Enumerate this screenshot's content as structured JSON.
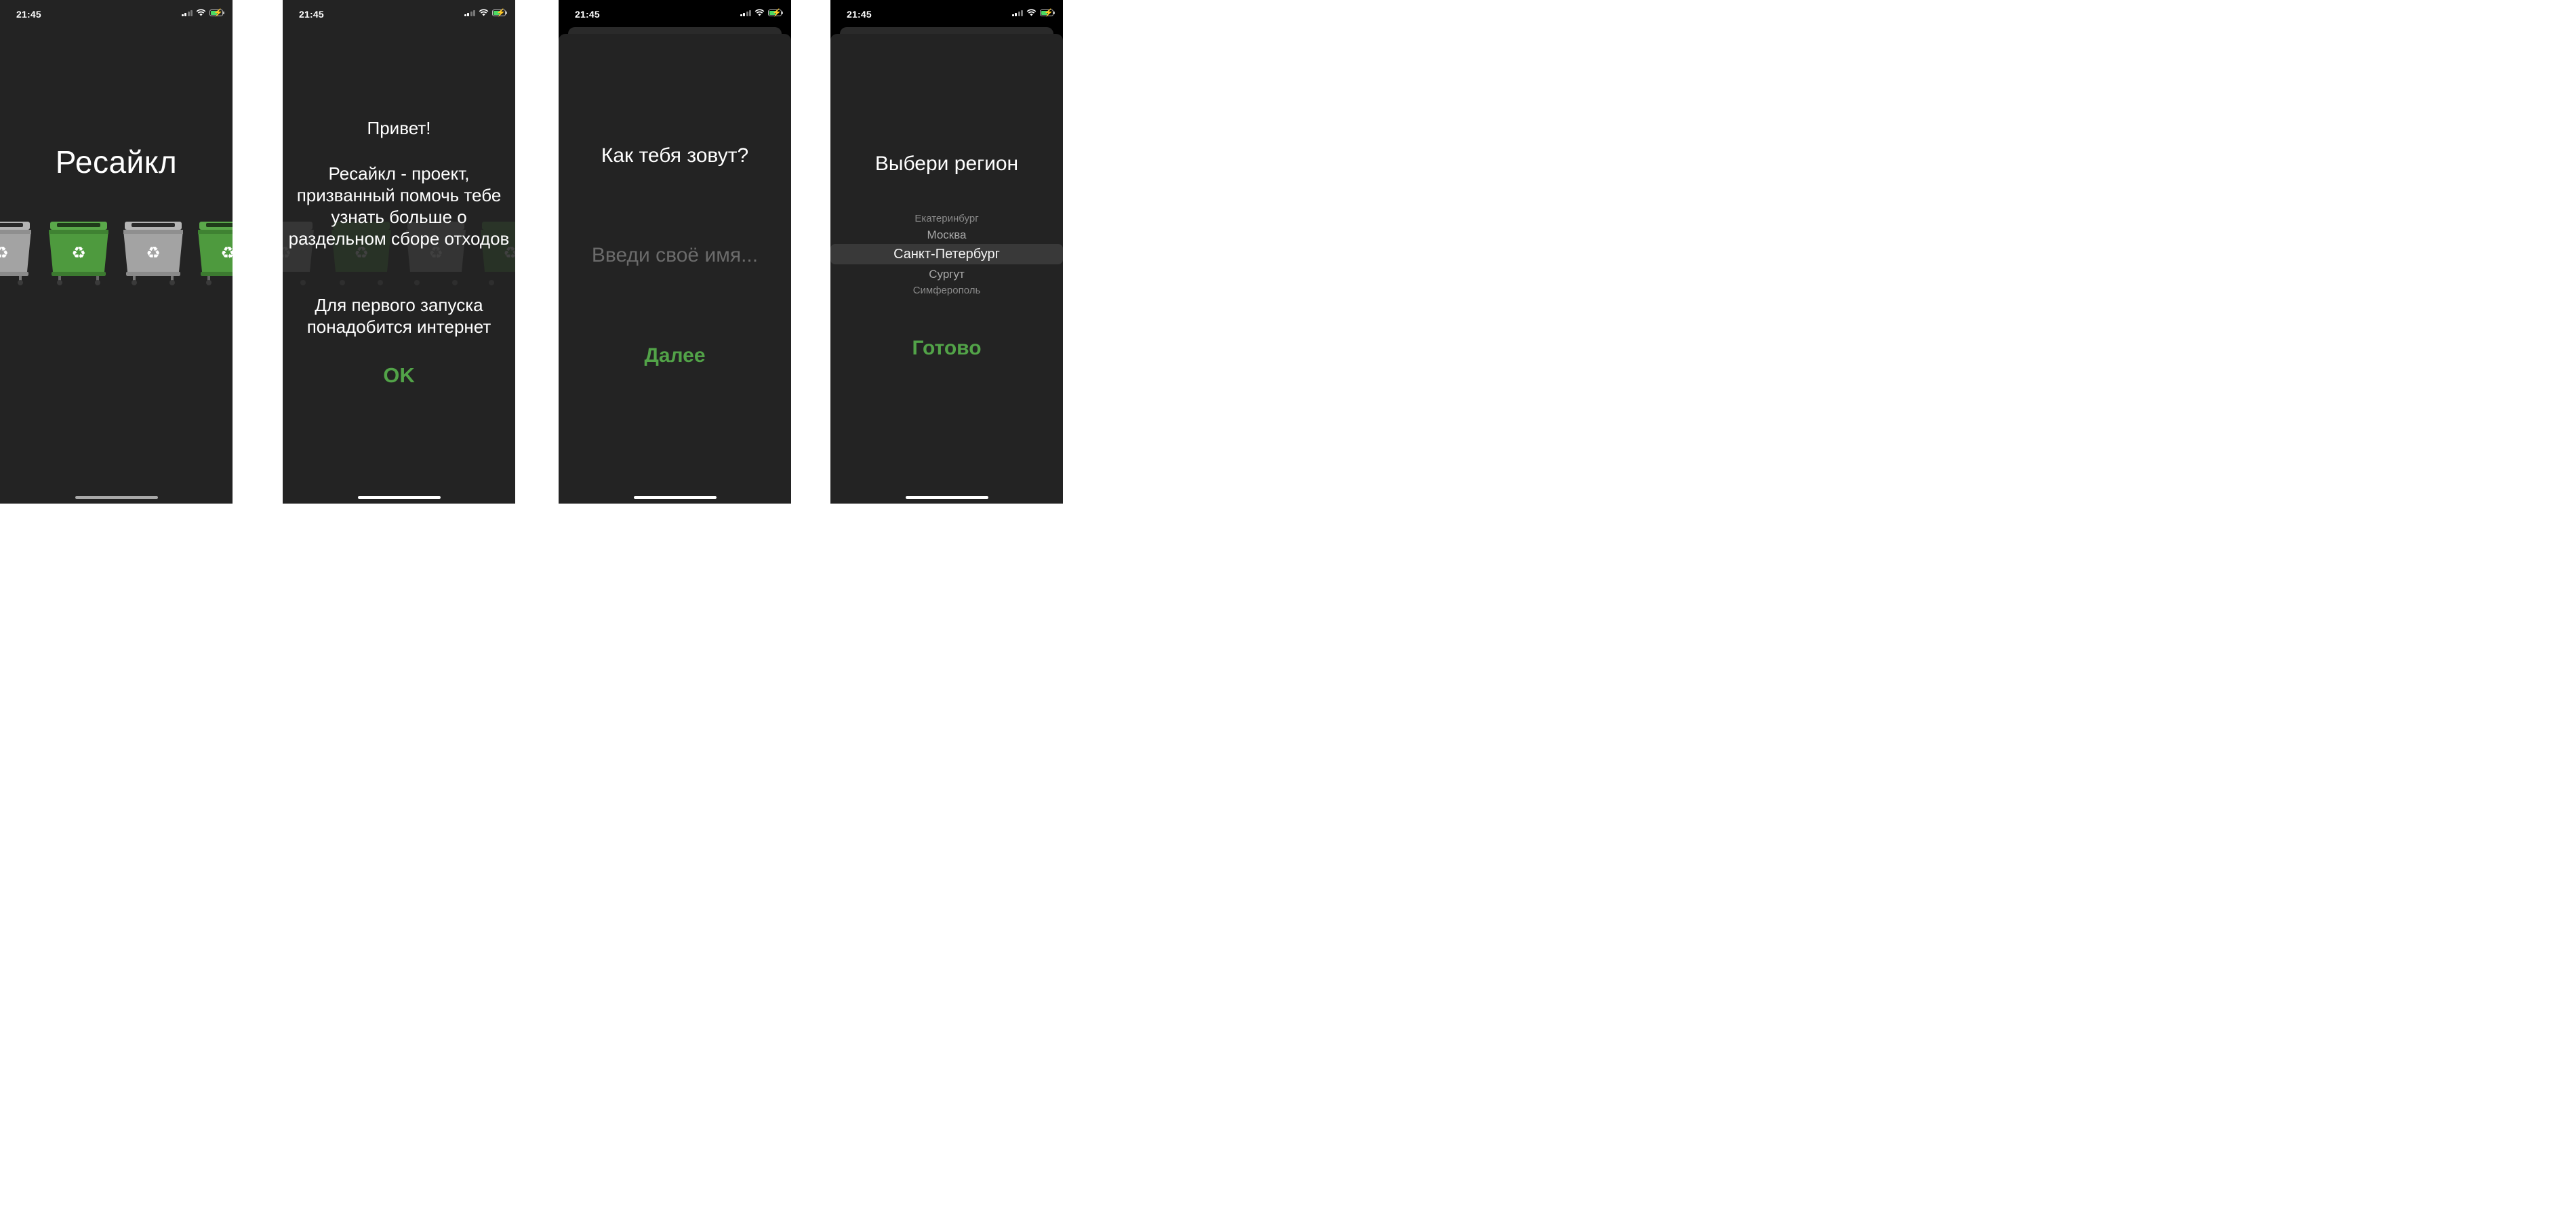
{
  "status": {
    "time": "21:45"
  },
  "colors": {
    "accent_green": "#52a348",
    "background": "#232323",
    "bin_green": "#4e9a3e",
    "bin_grey": "#a3a3a3"
  },
  "screen1": {
    "title": "Ресайкл",
    "bins": [
      "grey-bin",
      "green-bin",
      "grey-bin",
      "green-bin"
    ]
  },
  "screen2": {
    "title": "Привет!",
    "body": "Ресайкл - проект, призванный помочь тебе узнать больше о раздельном сборе отходов",
    "note": "Для первого запуска понадобится интернет",
    "ok_label": "OK"
  },
  "screen3": {
    "title": "Как тебя зовут?",
    "name_placeholder": "Введи своё имя...",
    "name_value": "",
    "next_label": "Далее"
  },
  "screen4": {
    "title": "Выбери регион",
    "regions": [
      "Екатеринбург",
      "Москва",
      "Санкт-Петербург",
      "Сургут",
      "Симферополь"
    ],
    "selected_region": "Санкт-Петербург",
    "done_label": "Готово"
  }
}
